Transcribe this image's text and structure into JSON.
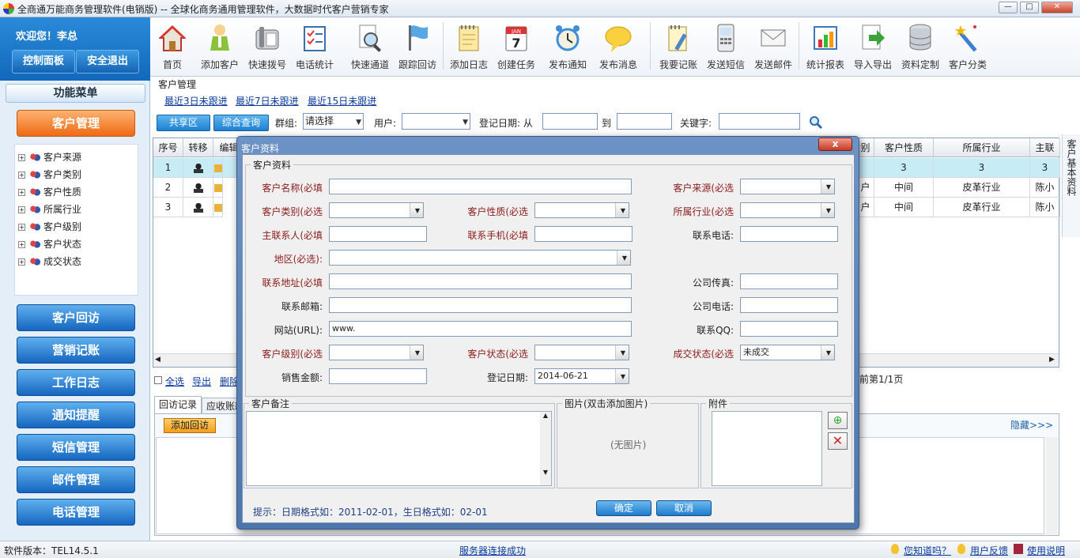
{
  "window": {
    "title": "全商通万能商务管理软件(电销版) -- 全球化商务通用管理软件，大数据时代客户营销专家",
    "min": "—",
    "max": "□",
    "close": "✕"
  },
  "user": {
    "welcome": "欢迎您！李总",
    "control_panel": "控制面板",
    "logout": "安全退出"
  },
  "toolbar": [
    {
      "label": "首页",
      "icon": "home-icon"
    },
    {
      "label": "添加客户",
      "icon": "add-customer-icon"
    },
    {
      "label": "快速拨号",
      "icon": "phone-icon"
    },
    {
      "label": "电话统计",
      "icon": "checklist-icon"
    },
    {
      "label": "快速通道",
      "icon": "magnifier-doc-icon"
    },
    {
      "label": "跟踪回访",
      "icon": "flag-icon"
    },
    {
      "label": "添加日志",
      "icon": "notepad-icon"
    },
    {
      "label": "创建任务",
      "icon": "calendar-icon"
    },
    {
      "label": "发布通知",
      "icon": "alarm-clock-icon"
    },
    {
      "label": "发布消息",
      "icon": "speech-bubble-icon"
    },
    {
      "label": "我要记账",
      "icon": "ledger-icon"
    },
    {
      "label": "发送短信",
      "icon": "mobile-icon"
    },
    {
      "label": "发送邮件",
      "icon": "envelope-icon"
    },
    {
      "label": "统计报表",
      "icon": "chart-icon"
    },
    {
      "label": "导入导出",
      "icon": "import-export-icon"
    },
    {
      "label": "资料定制",
      "icon": "database-icon"
    },
    {
      "label": "客户分类",
      "icon": "magic-wand-icon"
    }
  ],
  "calendar_icon": {
    "month": "JAN",
    "day": "7"
  },
  "sidebar": {
    "menu_title": "功能菜单",
    "customer_mgmt": "客户管理",
    "tree": [
      "客户来源",
      "客户类别",
      "客户性质",
      "所属行业",
      "客户级别",
      "客户状态",
      "成交状态"
    ],
    "buttons": [
      "客户回访",
      "营销记账",
      "工作日志",
      "通知提醒",
      "短信管理",
      "邮件管理",
      "电话管理"
    ]
  },
  "main": {
    "crumb": "客户管理",
    "quick_links": [
      "最近3日未跟进",
      "最近7日未跟进",
      "最近15日未跟进"
    ],
    "share_btn": "共享区",
    "query_btn": "综合查询",
    "group_label": "群组:",
    "group_value": "请选择",
    "user_label": "用户:",
    "date_label": "登记日期: 从",
    "to_label": "到",
    "keyword_label": "关键字:"
  },
  "grid": {
    "headers_left": [
      "序号",
      "转移",
      "编辑"
    ],
    "headers_right": [
      "别",
      "客户性质",
      "所属行业",
      "主联"
    ],
    "rows": [
      [
        "1",
        "",
        "",
        "",
        "3",
        "3",
        "3"
      ],
      [
        "2",
        "",
        "",
        "户",
        "中间",
        "皮革行业",
        "陈小"
      ],
      [
        "3",
        "",
        "",
        "户",
        "中间",
        "皮革行业",
        "陈小"
      ]
    ]
  },
  "bottom": {
    "select_all": "全选",
    "export": "导出",
    "delete": "删除",
    "page_info": "前第1/1页"
  },
  "tabs": {
    "items": [
      "回访记录",
      "应收账款"
    ],
    "add_visit": "添加回访",
    "hide": "隐藏>>>"
  },
  "side_tab": "客户基本资料",
  "status": {
    "version": "软件版本：TEL14.5.1",
    "server": "服务器连接成功",
    "tips": "您知道吗？",
    "feedback": "用户反馈",
    "help": "使用说明"
  },
  "dialog": {
    "title": "客户资料",
    "close": "x",
    "section": "客户资料",
    "fields": {
      "name": "客户名称(必填",
      "source": "客户来源(必选",
      "category": "客户类别(必选",
      "nature": "客户性质(必选",
      "industry": "所属行业(必选",
      "contact": "主联系人(必填",
      "mobile": "联系手机(必填",
      "phone": "联系电话:",
      "region": "地区(必选):",
      "address": "联系地址(必填",
      "fax": "公司传真:",
      "email": "联系邮箱:",
      "company_phone": "公司电话:",
      "website": "网站(URL):",
      "qq": "联系QQ:",
      "level": "客户级别(必选",
      "status": "客户状态(必选",
      "deal_status": "成交状态(必选",
      "sales": "销售金额:",
      "reg_date": "登记日期:"
    },
    "values": {
      "website": "www.",
      "deal_status": "未成交",
      "reg_date": "2014-06-21"
    },
    "notes_label": "客户备注",
    "picture_label": "图片(双击添加图片)",
    "no_picture": "(无图片)",
    "attach_label": "附件",
    "hint": "提示：日期格式如：2011-02-01，生日格式如：02-01",
    "ok": "确定",
    "cancel": "取消"
  }
}
